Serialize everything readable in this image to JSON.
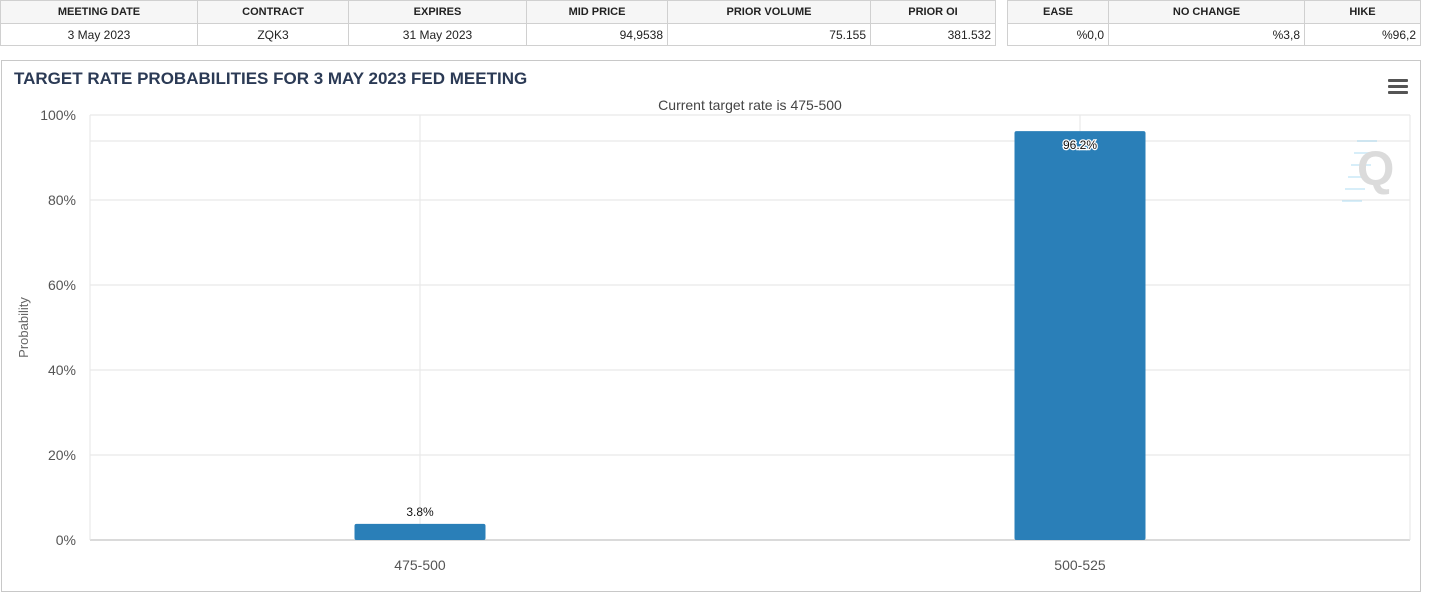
{
  "meeting_table": {
    "headers": [
      "MEETING DATE",
      "CONTRACT",
      "EXPIRES",
      "MID PRICE",
      "PRIOR VOLUME",
      "PRIOR OI"
    ],
    "row": [
      "3 May 2023",
      "ZQK3",
      "31 May 2023",
      "94,9538",
      "75.155",
      "381.532"
    ]
  },
  "probability_table": {
    "headers": [
      "EASE",
      "NO CHANGE",
      "HIKE"
    ],
    "row": [
      "%0,0",
      "%3,8",
      "%96,2"
    ]
  },
  "chart_data": {
    "type": "bar",
    "title": "TARGET RATE PROBABILITIES FOR 3 MAY 2023 FED MEETING",
    "subtitle": "Current target rate is 475-500",
    "xlabel": "",
    "ylabel": "Probability",
    "categories": [
      "475-500",
      "500-525"
    ],
    "values": [
      3.8,
      96.2
    ],
    "data_labels": [
      "3.8%",
      "96.2%"
    ],
    "ylim": [
      0,
      100
    ],
    "yticks": [
      0,
      20,
      40,
      60,
      80,
      100
    ],
    "ytick_labels": [
      "0%",
      "20%",
      "40%",
      "60%",
      "80%",
      "100%"
    ],
    "grid": true,
    "bar_color": "#2a7fb8"
  }
}
